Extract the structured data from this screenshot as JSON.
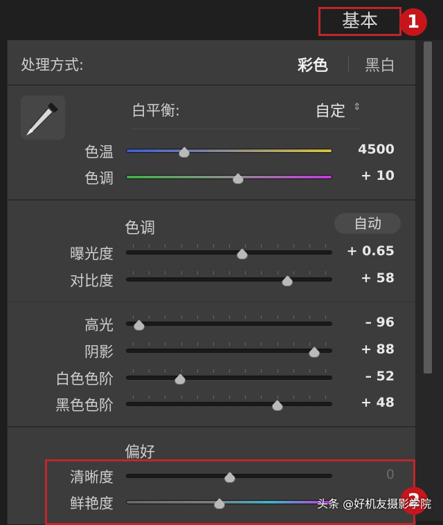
{
  "panel": {
    "title": "基本",
    "callout_1": "1",
    "callout_2": "2"
  },
  "treatment": {
    "label": "处理方式:",
    "color": "彩色",
    "bw": "黑白"
  },
  "white_balance": {
    "label": "白平衡:",
    "preset": "自定",
    "preset_arrow": "⇕",
    "sliders": [
      {
        "label": "色温",
        "value": "4500",
        "position": 0.28
      },
      {
        "label": "色调",
        "value": "+ 10",
        "position": 0.54
      }
    ]
  },
  "tone": {
    "heading": "色调",
    "auto": "自动",
    "sliders": [
      {
        "label": "曝光度",
        "value": "+ 0.65",
        "position": 0.56
      },
      {
        "label": "对比度",
        "value": "+ 58",
        "position": 0.78
      },
      {
        "label": "高光",
        "value": "– 96",
        "position": 0.06
      },
      {
        "label": "阴影",
        "value": "+ 88",
        "position": 0.91
      },
      {
        "label": "白色色阶",
        "value": "– 52",
        "position": 0.26
      },
      {
        "label": "黑色色阶",
        "value": "+ 48",
        "position": 0.73
      }
    ]
  },
  "presence": {
    "heading": "偏好",
    "sliders": [
      {
        "label": "清晰度",
        "value": "0",
        "position": 0.5
      },
      {
        "label": "鲜艳度",
        "value": "",
        "position": 0.45
      }
    ]
  },
  "watermark": "头条 @好机友摄影学院",
  "colors": {
    "accent_red": "#c0262b",
    "panel_bg": "#3c3c3c"
  }
}
